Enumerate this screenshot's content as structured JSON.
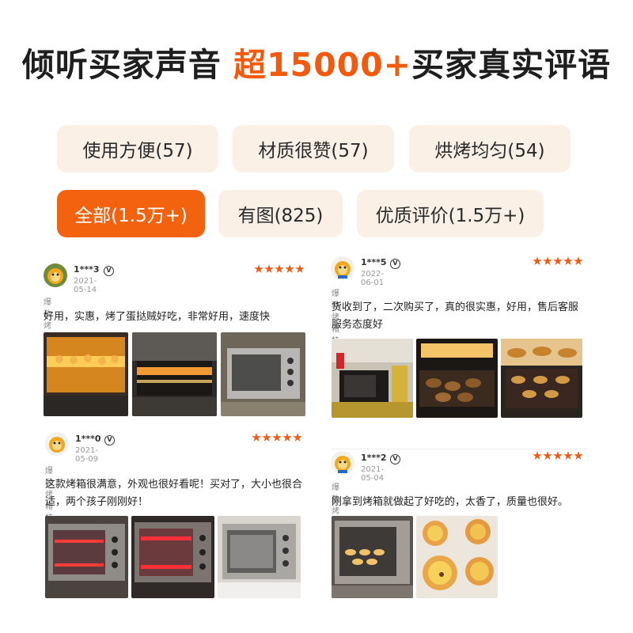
{
  "headline": {
    "prefix": "倾听买家声音 ",
    "highlight": "超15000+",
    "suffix": "买家真实评语"
  },
  "filters": [
    {
      "label": "使用方便(57)",
      "active": false
    },
    {
      "label": "材质很赞(57)",
      "active": false
    },
    {
      "label": "烘烤均匀(54)",
      "active": false
    },
    {
      "label": "全部(1.5万+)",
      "active": true
    },
    {
      "label": "有图(825)",
      "active": false
    },
    {
      "label": "优质评价(1.5万+)",
      "active": false
    }
  ],
  "reviews": [
    {
      "user": "1***3",
      "badge": "V",
      "date": "2021-05-14",
      "rating": 5,
      "tag": "爆款烤箱特惠推荐",
      "text": "好用，实惠，烤了蛋挞贼好吃，非常好用，速度快",
      "photos": [
        "oven-tray-photo",
        "oven-rack-photo",
        "oven-silver-photo"
      ]
    },
    {
      "user": "1***5",
      "badge": "V",
      "date": "2022-06-01",
      "rating": 5,
      "tag": "爆款烤箱特惠推荐",
      "text": "货收到了，二次购买了，真的很实惠，好用，售后客服服务态度好",
      "photos": [
        "oven-kitchen-photo",
        "oven-roast-photo",
        "oven-pastry-photo"
      ]
    },
    {
      "user": "1***0",
      "badge": "V",
      "date": "2021-05-09",
      "rating": 5,
      "tag": "爆款烤箱特惠推荐",
      "text": "这款烤箱很满意，外观也很好看呢！买对了，大小也很合适，两个孩子刚刚好！",
      "photos": [
        "oven-heating-photo",
        "oven-heating-2-photo",
        "oven-white-photo"
      ]
    },
    {
      "user": "1***2",
      "badge": "V",
      "date": "2021-05-04",
      "rating": 5,
      "tag": "爆款烤箱特惠推荐",
      "text": "刚拿到烤箱就做起了好吃的，太香了，质量也很好。",
      "photos": [
        "oven-tart-photo",
        "egg-tarts-photo"
      ]
    }
  ],
  "colors": {
    "accent": "#f3620f",
    "chip_bg": "#fbf0e6",
    "star": "#f05a14"
  }
}
